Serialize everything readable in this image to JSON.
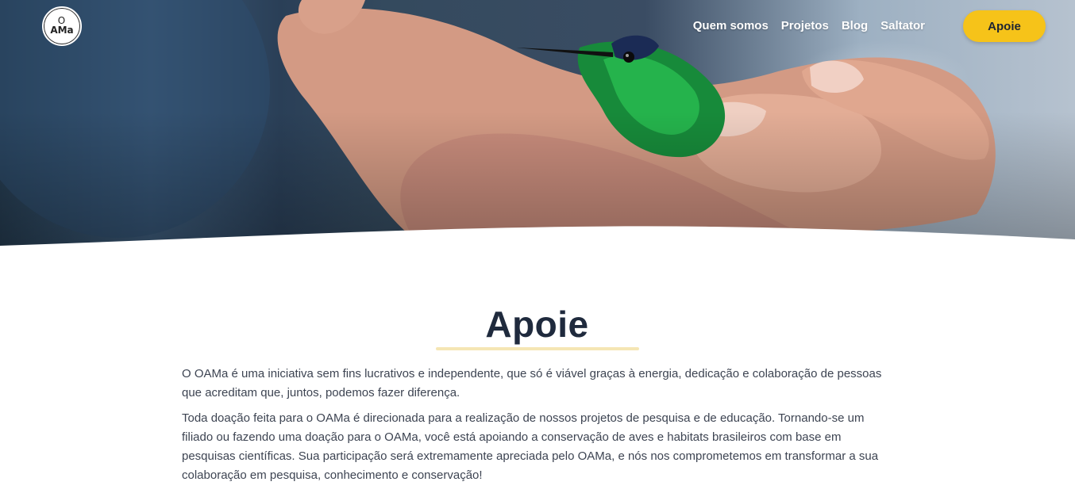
{
  "header": {
    "logo_text_line1": "O",
    "logo_text_line2": "AMa",
    "nav": [
      "Quem somos",
      "Projetos",
      "Blog",
      "Saltator"
    ],
    "cta_label": "Apoie"
  },
  "hero": {
    "image_alt": "Beija-flor verde pousado na mão"
  },
  "main": {
    "title": "Apoie",
    "paragraphs": [
      "O OAMa é uma iniciativa sem fins lucrativos e independente, que só é viável graças à energia, dedicação e colaboração de pessoas que acreditam que, juntos, podemos fazer diferença.",
      "Toda doação feita para o OAMa é direcionada para a realização de nossos projetos de pesquisa e de educação. Tornando-se um filiado ou fazendo uma doação para o OAMa, você está apoiando a conservação de aves e habitats brasileiros com base em pesquisas científicas. Sua participação será extremamente apreciada pelo OAMa, e nós nos comprometemos em transformar a sua colaboração em pesquisa, conhecimento e conservação!"
    ]
  },
  "colors": {
    "accent": "#f6c319",
    "title": "#1f2a3d",
    "underline": "#f5e6b4",
    "body_text": "#3d4452"
  }
}
